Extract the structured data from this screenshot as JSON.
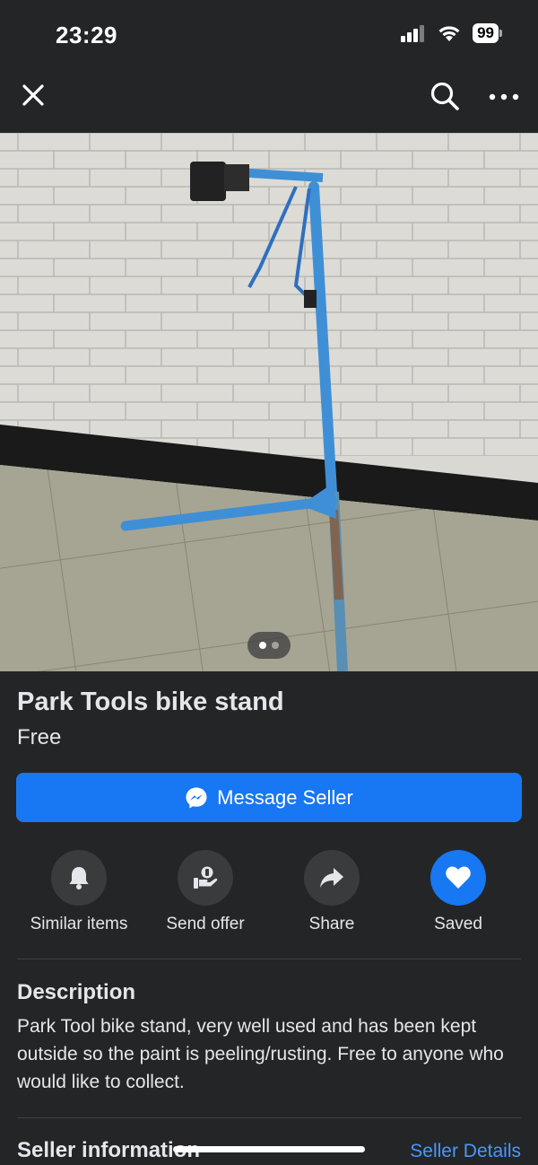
{
  "status": {
    "time": "23:29",
    "battery": "99"
  },
  "nav": {
    "close_icon": "close-icon",
    "search_icon": "search-icon",
    "more_icon": "more-icon"
  },
  "listing": {
    "title": "Park Tools bike stand",
    "price": "Free",
    "photo_count": 2,
    "photo_index": 1
  },
  "message_button": {
    "label": "Message Seller",
    "icon": "messenger-icon"
  },
  "actions": [
    {
      "label": "Similar items",
      "icon": "bell-icon"
    },
    {
      "label": "Send offer",
      "icon": "offer-icon"
    },
    {
      "label": "Share",
      "icon": "share-icon"
    },
    {
      "label": "Saved",
      "icon": "heart-icon",
      "active": true
    }
  ],
  "description": {
    "heading": "Description",
    "text": "Park Tool bike stand, very well used and has been kept outside so the paint is peeling/rusting. Free to anyone who would like to collect."
  },
  "seller": {
    "heading": "Seller information",
    "link": "Seller Details"
  },
  "colors": {
    "background": "#242526",
    "accent": "#1877f2",
    "link": "#4599ff"
  }
}
